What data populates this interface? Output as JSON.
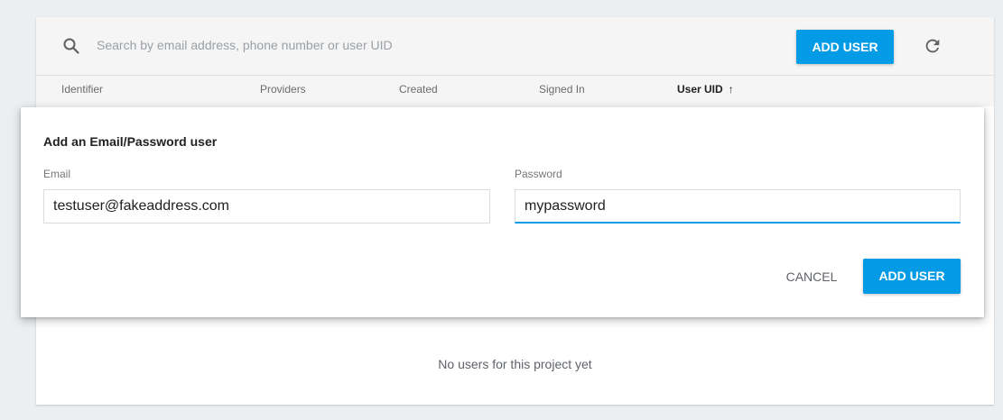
{
  "search": {
    "placeholder": "Search by email address, phone number or user UID"
  },
  "toolbar": {
    "add_user_label": "ADD USER",
    "icons": [
      "search-icon",
      "refresh-icon"
    ]
  },
  "table": {
    "columns": [
      "Identifier",
      "Providers",
      "Created",
      "Signed In",
      "User UID"
    ],
    "sorted_column": "User UID",
    "sort_direction": "ascending",
    "sort_arrow": "↑",
    "empty_message": "No users for this project yet"
  },
  "dialog": {
    "title": "Add an Email/Password user",
    "email_label": "Email",
    "email_value": "testuser@fakeaddress.com",
    "password_label": "Password",
    "password_value": "mypassword",
    "cancel_label": "CANCEL",
    "submit_label": "ADD USER"
  },
  "colors": {
    "accent": "#039be5",
    "background": "#eceff1",
    "toolbar_bg": "#f5f5f5"
  }
}
